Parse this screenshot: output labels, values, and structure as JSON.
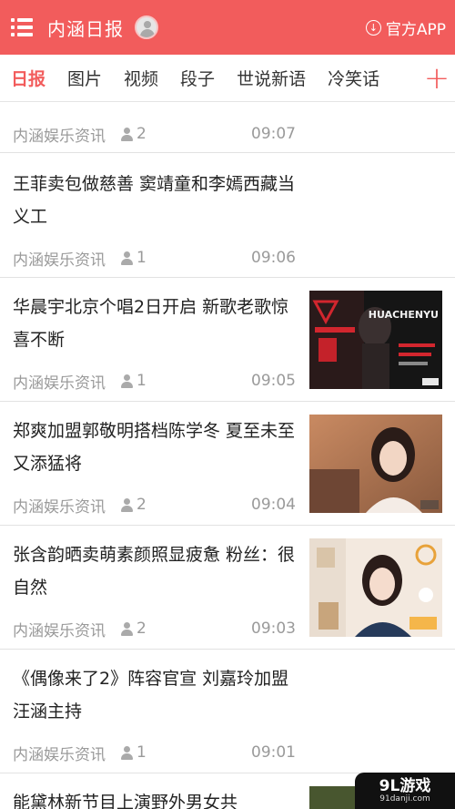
{
  "header": {
    "app_title": "内涵日报",
    "official_app_label": "官方APP"
  },
  "tabs": [
    {
      "label": "日报",
      "active": true
    },
    {
      "label": "图片",
      "active": false
    },
    {
      "label": "视频",
      "active": false
    },
    {
      "label": "段子",
      "active": false
    },
    {
      "label": "世说新语",
      "active": false
    },
    {
      "label": "冷笑话",
      "active": false
    }
  ],
  "add_tab_label": "+",
  "articles": [
    {
      "title": "",
      "source": "内涵娱乐资讯",
      "comments": "2",
      "time": "09:07",
      "has_thumb": false
    },
    {
      "title": "王菲卖包做慈善 窦靖童和李嫣西藏当义工",
      "source": "内涵娱乐资讯",
      "comments": "1",
      "time": "09:06",
      "has_thumb": false
    },
    {
      "title": "华晨宇北京个唱2日开启 新歌老歌惊喜不断",
      "source": "内涵娱乐资讯",
      "comments": "1",
      "time": "09:05",
      "has_thumb": true,
      "thumb_text": "HUACHENYU"
    },
    {
      "title": "郑爽加盟郭敬明搭档陈学冬 夏至未至又添猛将",
      "source": "内涵娱乐资讯",
      "comments": "2",
      "time": "09:04",
      "has_thumb": true
    },
    {
      "title": "张含韵晒卖萌素颜照显疲惫 粉丝：很自然",
      "source": "内涵娱乐资讯",
      "comments": "2",
      "time": "09:03",
      "has_thumb": true
    },
    {
      "title": "《偶像来了2》阵容官宣 刘嘉玲加盟汪涵主持",
      "source": "内涵娱乐资讯",
      "comments": "1",
      "time": "09:01",
      "has_thumb": false
    },
    {
      "title": "能黛林新节目上演野外男女共",
      "source": "",
      "comments": "",
      "time": "",
      "has_thumb": true
    }
  ],
  "watermark": {
    "main": "9L游戏",
    "sub": "91danji.com"
  },
  "colors": {
    "accent": "#f25c5c",
    "meta_gray": "#9a9a9a",
    "divider": "#e2e2e2"
  },
  "icons": [
    "menu-icon",
    "avatar-icon",
    "download-icon",
    "person-icon",
    "add-icon"
  ]
}
